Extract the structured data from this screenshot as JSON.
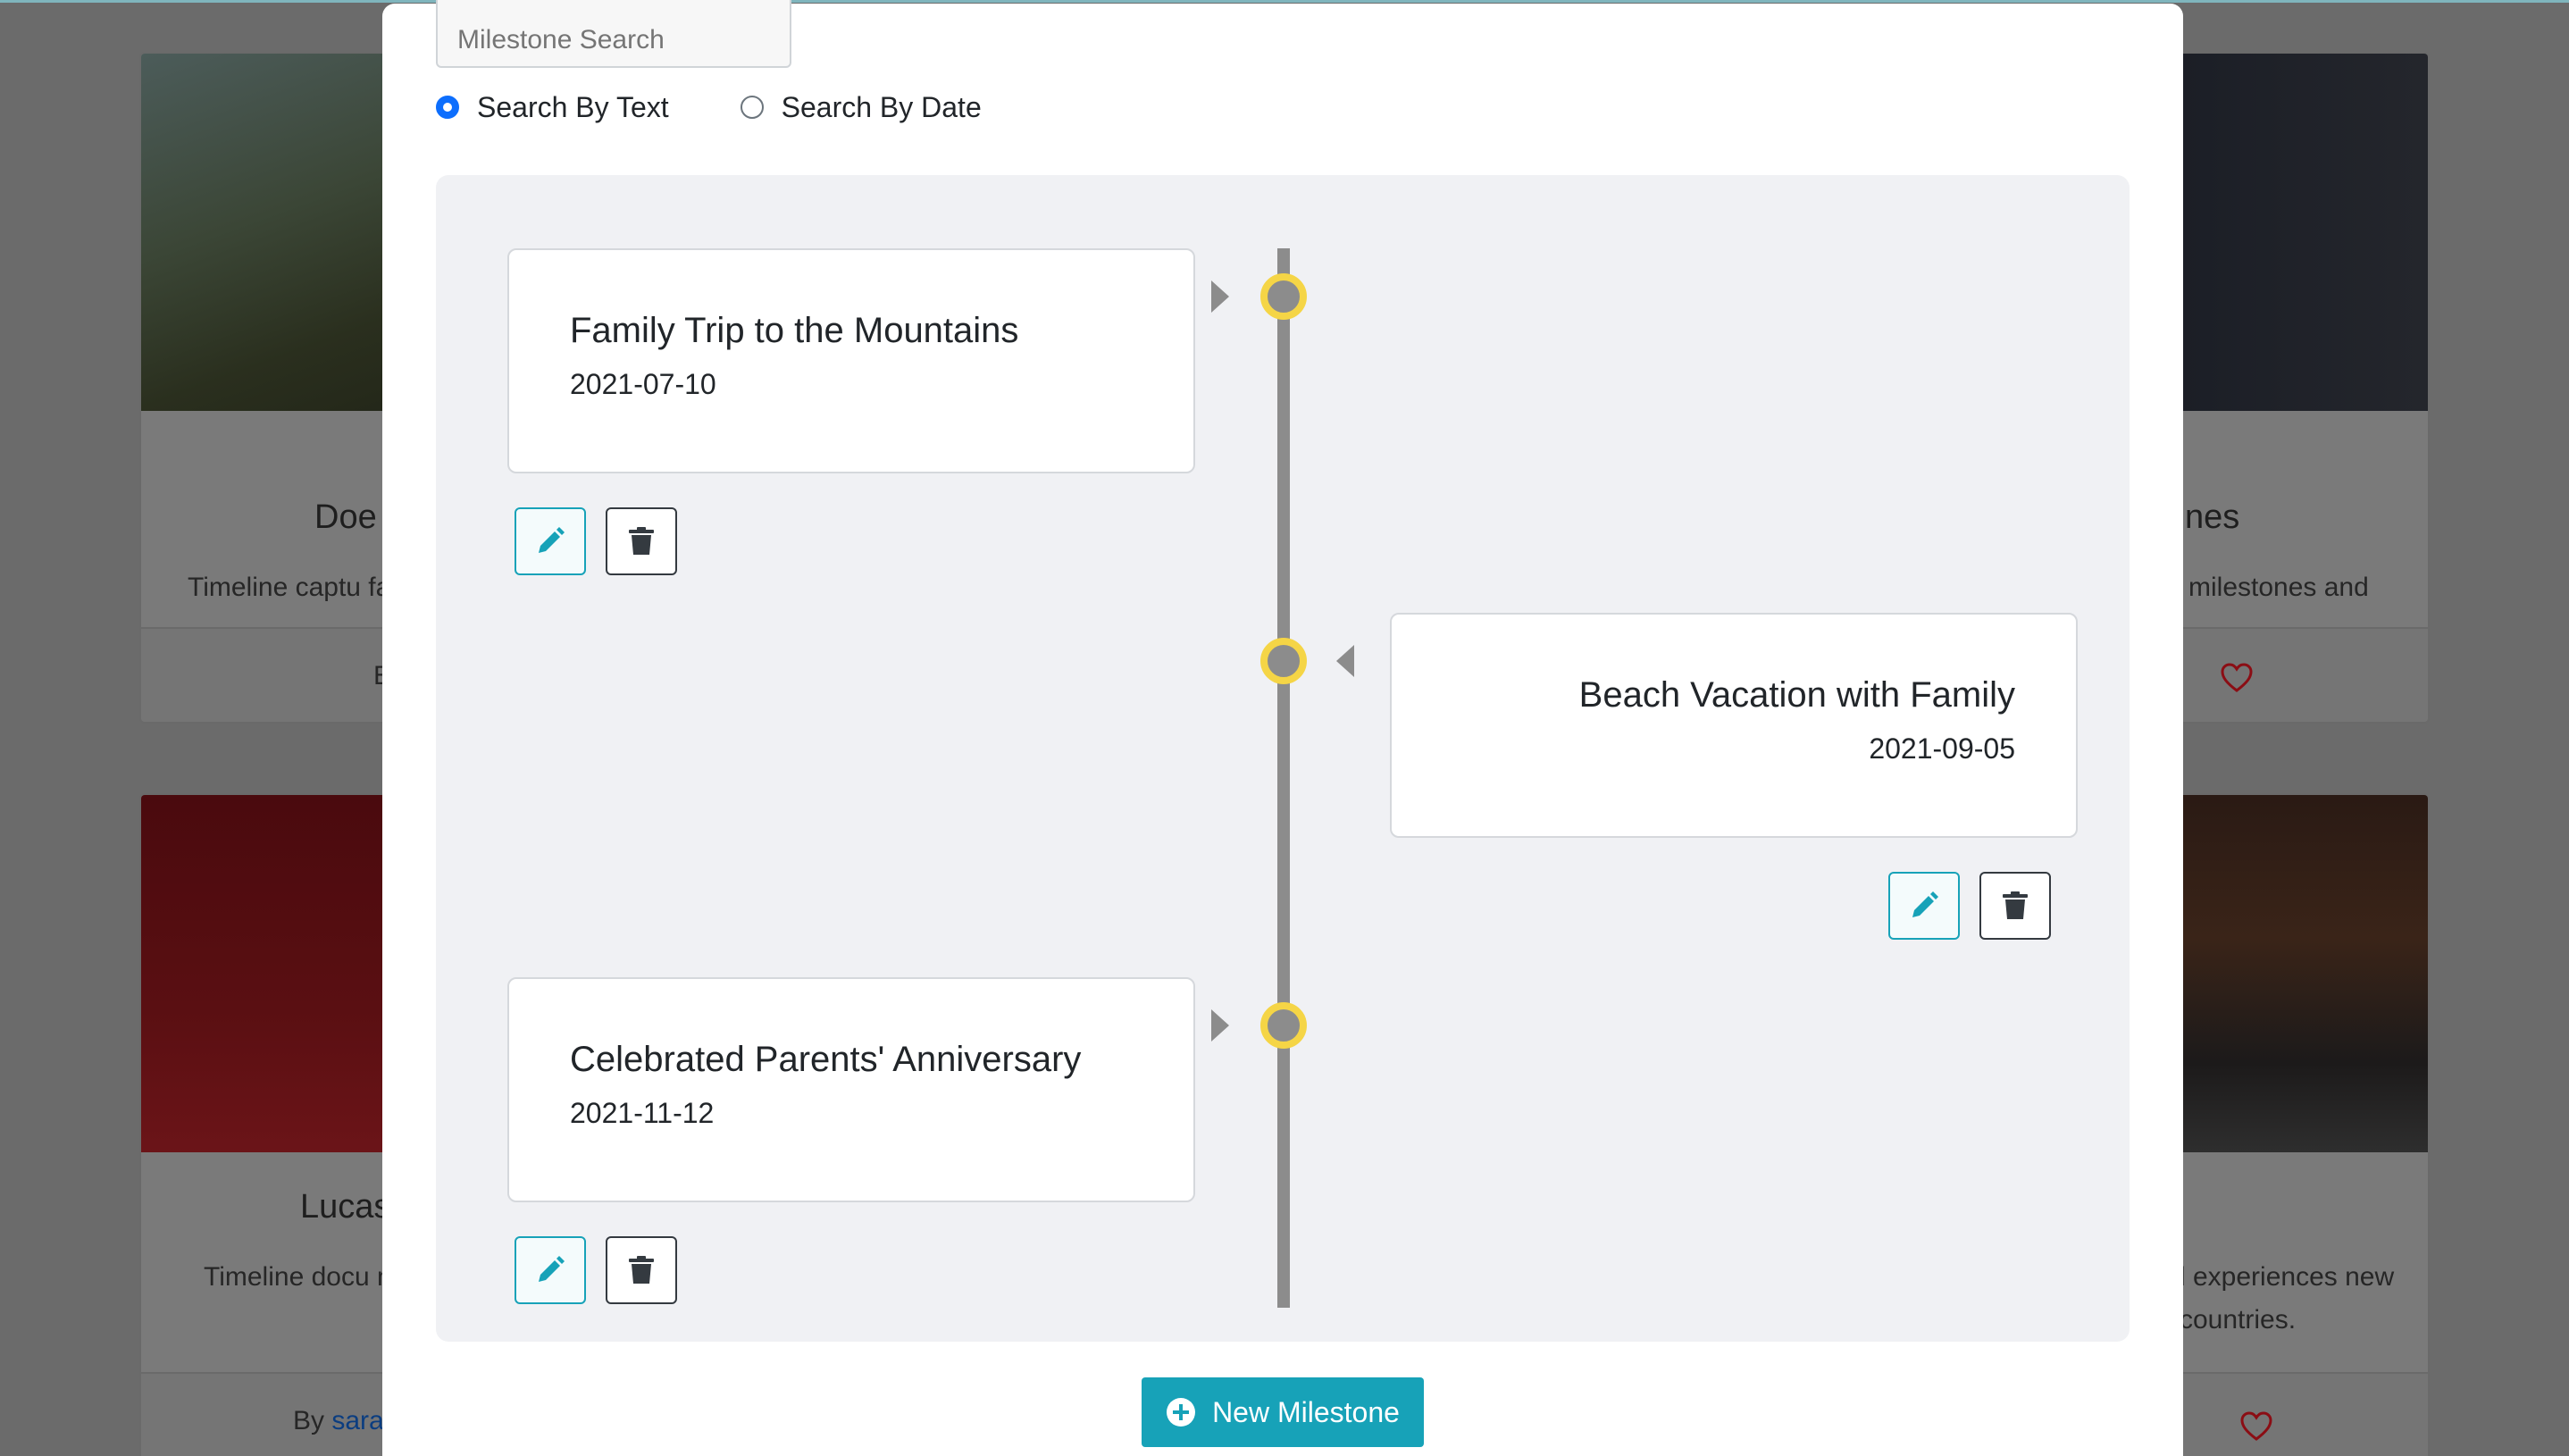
{
  "background_cards": [
    {
      "title": "Doe",
      "description": "Timeline captu fam",
      "footer_text": "E"
    },
    {
      "title": "nes",
      "description": "milestones and"
    },
    {
      "title": "Lucas",
      "description": "Timeline docu m",
      "footer_by": "By",
      "footer_user": "sara"
    },
    {
      "title": "",
      "description": "l experiences new countries."
    }
  ],
  "modal": {
    "search": {
      "placeholder": "Milestone Search"
    },
    "radios": [
      {
        "label": "Search By Text",
        "checked": true
      },
      {
        "label": "Search By Date",
        "checked": false
      }
    ],
    "milestones": [
      {
        "title": "Family Trip to the Mountains",
        "date": "2021-07-10",
        "side": "left"
      },
      {
        "title": "Beach Vacation with Family",
        "date": "2021-09-05",
        "side": "right"
      },
      {
        "title": "Celebrated Parents' Anniversary",
        "date": "2021-11-12",
        "side": "left"
      }
    ],
    "new_button_label": "New Milestone"
  },
  "colors": {
    "accent": "#17a2b8",
    "node_ring": "#f5d546",
    "axis": "#8c8c8c",
    "radio_checked": "#0d6efd",
    "heart": "#8b0d14"
  },
  "icons": {
    "edit": "pencil-icon",
    "delete": "trash-icon",
    "new": "plus-circle-icon",
    "like": "heart-icon"
  }
}
